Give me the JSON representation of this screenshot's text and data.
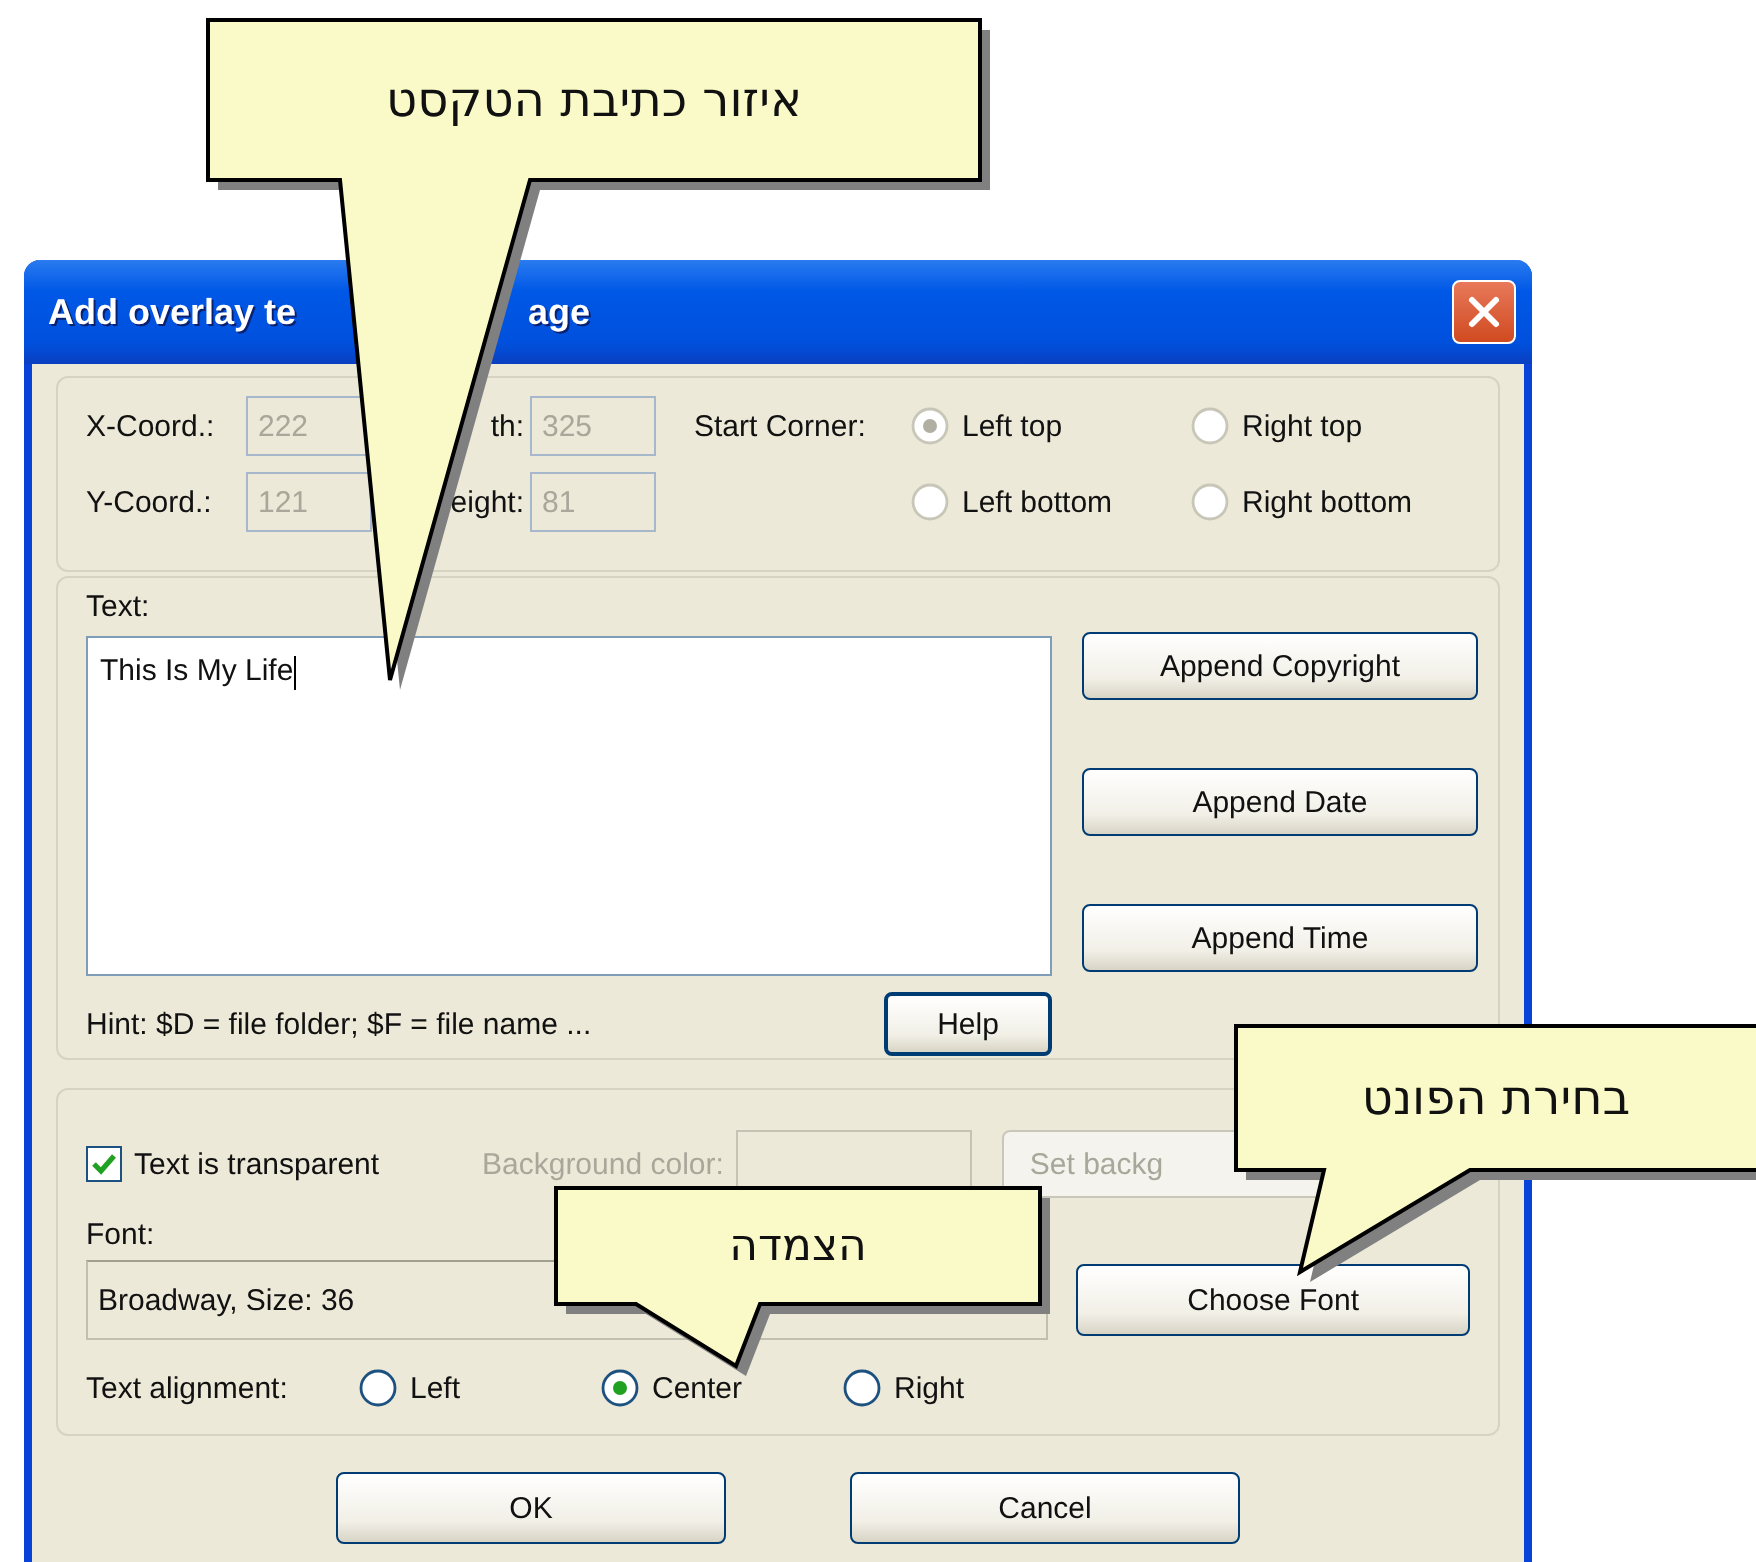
{
  "window": {
    "title_parts": [
      "Add overlay te",
      "age"
    ]
  },
  "position": {
    "disabled": true,
    "x_label": "X-Coord.:",
    "x_value": "222",
    "width_label": "th:",
    "width_value": "325",
    "y_label": "Y-Coord.:",
    "y_value": "121",
    "height_label": "eight:",
    "height_value": "81",
    "start_corner_label": "Start Corner:",
    "corners": [
      {
        "label": "Left top",
        "selected": true
      },
      {
        "label": "Right top",
        "selected": false
      },
      {
        "label": "Left bottom",
        "selected": false
      },
      {
        "label": "Right bottom",
        "selected": false
      }
    ]
  },
  "text_section": {
    "label": "Text:",
    "value": "This Is My Life",
    "hint": "Hint: $D = file folder; $F = file name ...",
    "help_button": "Help",
    "buttons": [
      {
        "label": "Append Copyright"
      },
      {
        "label": "Append Date"
      },
      {
        "label": "Append Time"
      }
    ]
  },
  "appearance": {
    "transparent": {
      "label": "Text is transparent",
      "checked": true
    },
    "background_label": "Background color:",
    "background_disabled": true,
    "set_background_button": {
      "label": "Set backg",
      "disabled": true
    },
    "font_label": "Font:",
    "font_value": "Broadway, Size: 36",
    "choose_font_button": "Choose Font",
    "alignment_label": "Text alignment:",
    "alignments": [
      {
        "label": "Left",
        "selected": false
      },
      {
        "label": "Center",
        "selected": true
      },
      {
        "label": "Right",
        "selected": false
      }
    ]
  },
  "buttons": [
    {
      "label": "OK"
    },
    {
      "label": "Cancel"
    }
  ],
  "callouts": [
    {
      "text": "איזור כתיבת הטקסט"
    },
    {
      "text": "בחירת הפונט"
    },
    {
      "text": "הצמדה"
    }
  ]
}
